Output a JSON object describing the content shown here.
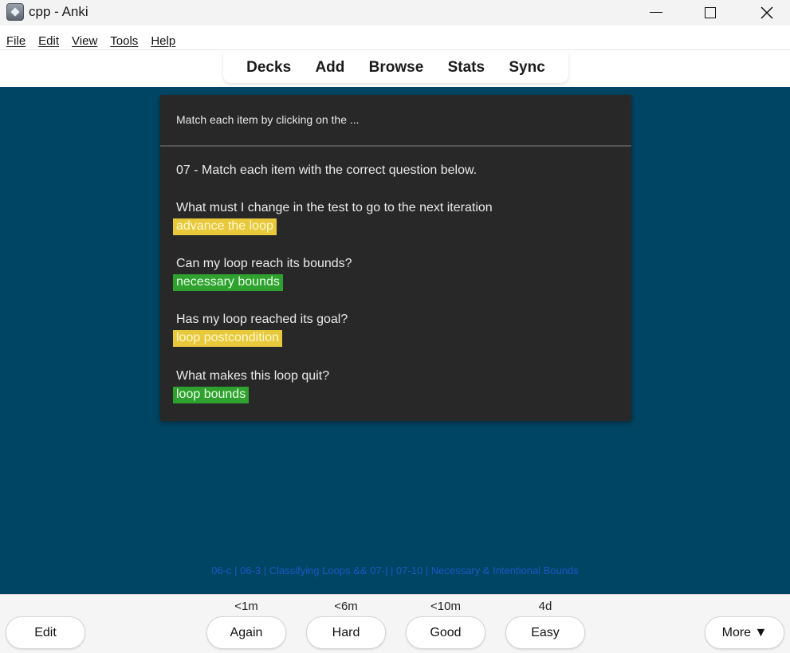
{
  "window": {
    "title": "cpp - Anki",
    "app_icon": "anki-icon"
  },
  "menu": [
    "File",
    "Edit",
    "View",
    "Tools",
    "Help"
  ],
  "toolbar": {
    "decks": "Decks",
    "add": "Add",
    "browse": "Browse",
    "stats": "Stats",
    "sync": "Sync"
  },
  "card": {
    "front": "Match each item by clicking on the ...",
    "instruction": "07 - Match each item with the correct question below.",
    "items": [
      {
        "question": "What must I change in the test to go to the next iteration",
        "answer": "advance the loop",
        "status_color": "#e8c93c"
      },
      {
        "question": "Can my loop reach its bounds?",
        "answer": "necessary bounds",
        "status_color": "#2fa12f"
      },
      {
        "question": "Has my loop reached its goal?",
        "answer": "loop postcondition",
        "status_color": "#e8c93c"
      },
      {
        "question": "What makes this loop quit?",
        "answer": "loop bounds",
        "status_color": "#2fa12f"
      }
    ],
    "tags": "06-c | 06-3 | Classifying Loops && 07-| | 07-10 | Necessary & Intentional Bounds"
  },
  "bottom": {
    "edit": "Edit",
    "more": "More ▼",
    "answers": [
      {
        "interval": "<1m",
        "label": "Again"
      },
      {
        "interval": "<6m",
        "label": "Hard"
      },
      {
        "interval": "<10m",
        "label": "Good"
      },
      {
        "interval": "4d",
        "label": "Easy"
      }
    ]
  },
  "colors": {
    "review_background": "#004664",
    "card_background": "#282828",
    "tag_text": "#1d56c4"
  }
}
